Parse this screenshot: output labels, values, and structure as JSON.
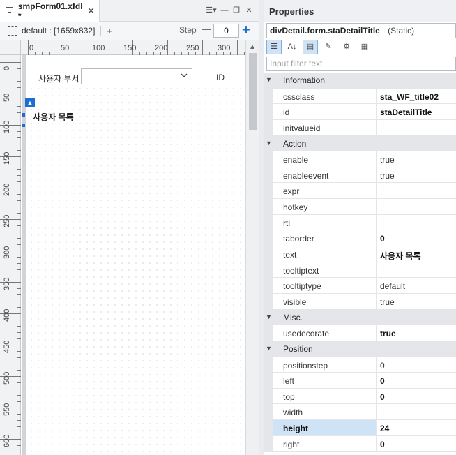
{
  "editor": {
    "tab_title": "smpForm01.xfdl *",
    "tab_close": "✕",
    "window_controls": [
      "☰▾",
      "—",
      "❐",
      "✕"
    ],
    "layout_label": "default : [1659x832]",
    "layout_add": "+",
    "step_label": "Step",
    "step_minus": "—",
    "step_value": "0",
    "step_plus": "+",
    "ruler_h": [
      "0",
      "50",
      "100",
      "150",
      "200",
      "250",
      "300"
    ],
    "ruler_v": [
      "0",
      "50",
      "100",
      "150",
      "200",
      "250",
      "300",
      "350",
      "400",
      "450",
      "500",
      "550",
      "600"
    ],
    "form": {
      "dept_label": "사용자 부서",
      "dept_value": "",
      "id_label": "ID",
      "title_static": "사용자 목록",
      "anchor_glyph": "▲"
    },
    "scroll_arrow": "▲"
  },
  "properties": {
    "panel_title": "Properties",
    "object_name": "divDetail.form.staDetailTitle",
    "object_type": "(Static)",
    "buttons": [
      {
        "icon": "categorized-icon",
        "glyph": "☰",
        "active": true
      },
      {
        "icon": "sort-alpha-icon",
        "glyph": "A↓",
        "active": false
      },
      {
        "icon": "properties-icon",
        "glyph": "▤",
        "active": true
      },
      {
        "icon": "events-icon",
        "glyph": "✎",
        "active": false
      },
      {
        "icon": "settings-icon",
        "glyph": "⚙",
        "active": false
      },
      {
        "icon": "init-icon",
        "glyph": "▦",
        "active": false
      }
    ],
    "filter_placeholder": "Input filter text",
    "rows": [
      {
        "kind": "cat",
        "name": "Information"
      },
      {
        "kind": "prop",
        "name": "cssclass",
        "value": "sta_WF_title02",
        "bold": true
      },
      {
        "kind": "prop",
        "name": "id",
        "value": "staDetailTitle",
        "bold": true
      },
      {
        "kind": "prop",
        "name": "initvalueid",
        "value": "",
        "bold": false
      },
      {
        "kind": "cat",
        "name": "Action"
      },
      {
        "kind": "prop",
        "name": "enable",
        "value": "true",
        "bold": false
      },
      {
        "kind": "prop",
        "name": "enableevent",
        "value": "true",
        "bold": false
      },
      {
        "kind": "prop",
        "name": "expr",
        "value": "",
        "bold": false
      },
      {
        "kind": "prop",
        "name": "hotkey",
        "value": "",
        "bold": false
      },
      {
        "kind": "prop",
        "name": "rtl",
        "value": "",
        "bold": false
      },
      {
        "kind": "prop",
        "name": "taborder",
        "value": "0",
        "bold": true
      },
      {
        "kind": "prop",
        "name": "text",
        "value": "사용자 목록",
        "bold": true
      },
      {
        "kind": "prop",
        "name": "tooltiptext",
        "value": "",
        "bold": false
      },
      {
        "kind": "prop",
        "name": "tooltiptype",
        "value": "default",
        "bold": false
      },
      {
        "kind": "prop",
        "name": "visible",
        "value": "true",
        "bold": false
      },
      {
        "kind": "cat",
        "name": "Misc."
      },
      {
        "kind": "prop",
        "name": "usedecorate",
        "value": "true",
        "bold": true
      },
      {
        "kind": "cat",
        "name": "Position"
      },
      {
        "kind": "prop",
        "name": "positionstep",
        "value": "0",
        "bold": false
      },
      {
        "kind": "prop",
        "name": "left",
        "value": "0",
        "bold": true
      },
      {
        "kind": "prop",
        "name": "top",
        "value": "0",
        "bold": true
      },
      {
        "kind": "prop",
        "name": "width",
        "value": "",
        "bold": false
      },
      {
        "kind": "prop",
        "name": "height",
        "value": "24",
        "bold": true,
        "selected": true
      },
      {
        "kind": "prop",
        "name": "right",
        "value": "0",
        "bold": true
      }
    ]
  },
  "colors": {
    "accent": "#1b6fd0",
    "selection": "#cfe3f7"
  }
}
